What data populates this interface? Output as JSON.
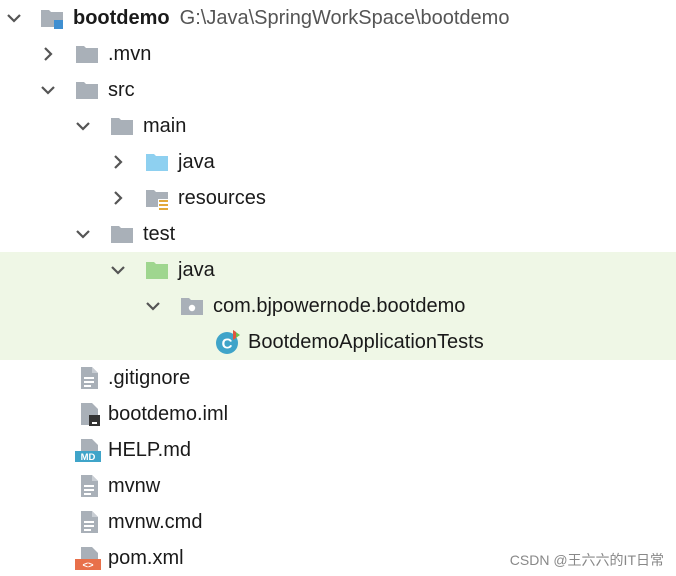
{
  "project": {
    "name": "bootdemo",
    "path": "G:\\Java\\SpringWorkSpace\\bootdemo"
  },
  "items": {
    "mvn": ".mvn",
    "src": "src",
    "main": "main",
    "main_java": "java",
    "resources": "resources",
    "test": "test",
    "test_java": "java",
    "package": "com.bjpowernode.bootdemo",
    "test_class": "BootdemoApplicationTests",
    "gitignore": ".gitignore",
    "iml": "bootdemo.iml",
    "help": "HELP.md",
    "mvnw": "mvnw",
    "mvnw_cmd": "mvnw.cmd",
    "pom": "pom.xml"
  },
  "icon_text": {
    "md": "MD",
    "class": "C",
    "xml": "<>"
  },
  "watermark": "CSDN @王六六的IT日常",
  "colors": {
    "highlight": "#eff7e6",
    "folder": "#a9b0b8",
    "source_folder": "#8ed0f0",
    "test_folder": "#9fd68f",
    "class_icon": "#3fa4c9"
  }
}
